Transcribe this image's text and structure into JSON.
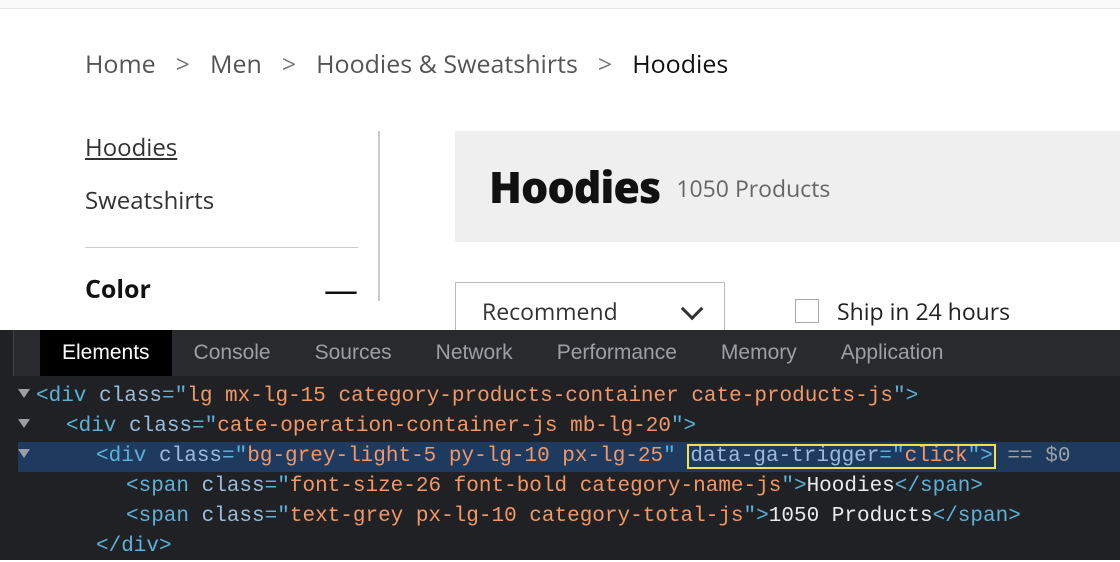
{
  "breadcrumb": {
    "home": "Home",
    "men": "Men",
    "category": "Hoodies & Sweatshirts",
    "current": "Hoodies",
    "sep": ">"
  },
  "sidebar": {
    "hoodies": "Hoodies",
    "sweatshirts": "Sweatshirts",
    "filter_title": "Color",
    "minus": "—"
  },
  "banner": {
    "title": "Hoodies",
    "count": "1050 Products"
  },
  "controls": {
    "sort": "Recommend",
    "ship": "Ship in 24 hours"
  },
  "devtools": {
    "tabs": {
      "elements": "Elements",
      "console": "Console",
      "sources": "Sources",
      "network": "Network",
      "performance": "Performance",
      "memory": "Memory",
      "application": "Application"
    },
    "l1": {
      "open": "<div ",
      "class_k": "class",
      "eq": "=\"",
      "class_v": "lg mx-lg-15 category-products-container cate-products-js",
      "close": "\">"
    },
    "l2": {
      "open": "<div ",
      "class_k": "class",
      "eq": "=\"",
      "class_v": "cate-operation-container-js mb-lg-20",
      "close": "\">"
    },
    "l3": {
      "open": "<div ",
      "class_k": "class",
      "eq": "=\"",
      "class_v": "bg-grey-light-5 py-lg-10 px-lg-25",
      "mid": "\" ",
      "attr_k": "data-ga-trigger",
      "eq2": "=\"",
      "attr_v": "click",
      "close": "\">",
      "tail": " == $0"
    },
    "l4": {
      "open": "<span ",
      "class_k": "class",
      "eq": "=\"",
      "class_v": "font-size-26 font-bold category-name-js",
      "mid": "\">",
      "text": "Hoodies",
      "close": "</span>"
    },
    "l5": {
      "open": "<span ",
      "class_k": "class",
      "eq": "=\"",
      "class_v": "text-grey px-lg-10 category-total-js",
      "mid": "\">",
      "text": "1050 Products",
      "close": "</span>"
    },
    "l6": {
      "close": "</div>"
    }
  }
}
